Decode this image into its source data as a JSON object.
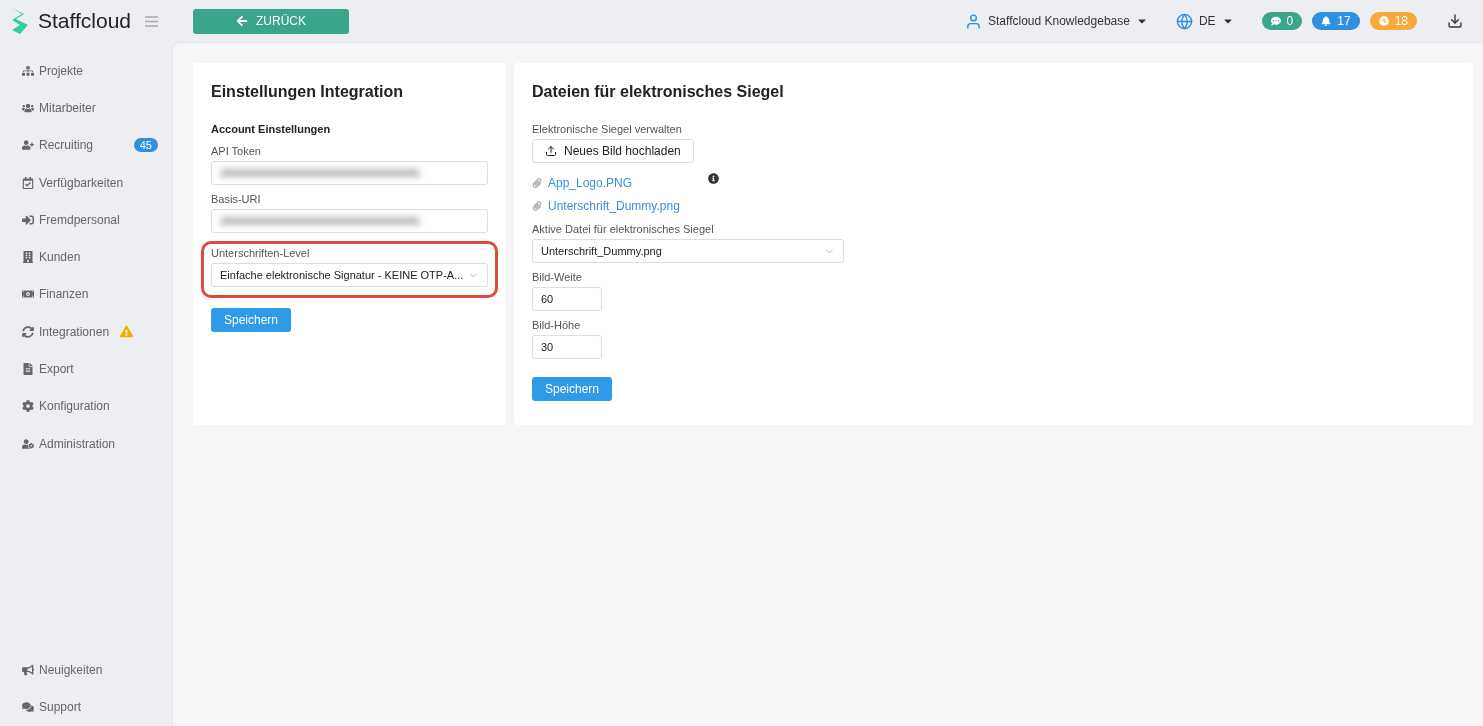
{
  "brand": {
    "name": "Staffcloud"
  },
  "back_button": {
    "label": "ZURÜCK"
  },
  "topbar": {
    "account": "Staffcloud Knowledgebase",
    "language": "DE",
    "badges": [
      {
        "kind": "chat",
        "count": "0",
        "color": "#3aa58b"
      },
      {
        "kind": "bell",
        "count": "17",
        "color": "#2f8fe0"
      },
      {
        "kind": "clock",
        "count": "18",
        "color": "#f8a93b"
      }
    ]
  },
  "sidebar": {
    "items": [
      {
        "label": "Projekte",
        "warning": false
      },
      {
        "label": "Mitarbeiter",
        "warning": false
      },
      {
        "label": "Recruiting",
        "badge": "45",
        "warning": false
      },
      {
        "label": "Verfügbarkeiten",
        "warning": false
      },
      {
        "label": "Fremdpersonal",
        "warning": false
      },
      {
        "label": "Kunden",
        "warning": false
      },
      {
        "label": "Finanzen",
        "warning": false
      },
      {
        "label": "Integrationen",
        "warning": true
      },
      {
        "label": "Export",
        "warning": false
      },
      {
        "label": "Konfiguration",
        "warning": false
      },
      {
        "label": "Administration",
        "warning": false
      }
    ],
    "bottom_items": [
      {
        "label": "Neuigkeiten"
      },
      {
        "label": "Support"
      }
    ]
  },
  "integration_card": {
    "title": "Einstellungen Integration",
    "section": "Account Einstellungen",
    "fields": [
      {
        "kind": "redacted",
        "label": "API Token",
        "highlighted": false
      },
      {
        "kind": "redacted",
        "label": "Basis-URI",
        "highlighted": false
      },
      {
        "kind": "select",
        "label": "Unterschriften-Level",
        "value": "Einfache elektronische Signatur - KEINE OTP-A...",
        "highlighted": true
      }
    ],
    "save_button": "Speichern"
  },
  "seal_card": {
    "title": "Dateien für elektronisches Siegel",
    "manage_label": "Elektronische Siegel verwalten",
    "upload_button": "Neues Bild hochladen",
    "files": [
      "App_Logo.PNG",
      "Unterschrift_Dummy.png"
    ],
    "active_file": {
      "label": "Aktive Datei für elektronisches Siegel",
      "value": "Unterschrift_Dummy.png"
    },
    "width": {
      "label": "Bild-Weite",
      "value": "60"
    },
    "height": {
      "label": "Bild-Höhe",
      "value": "30"
    },
    "save_button": "Speichern"
  }
}
